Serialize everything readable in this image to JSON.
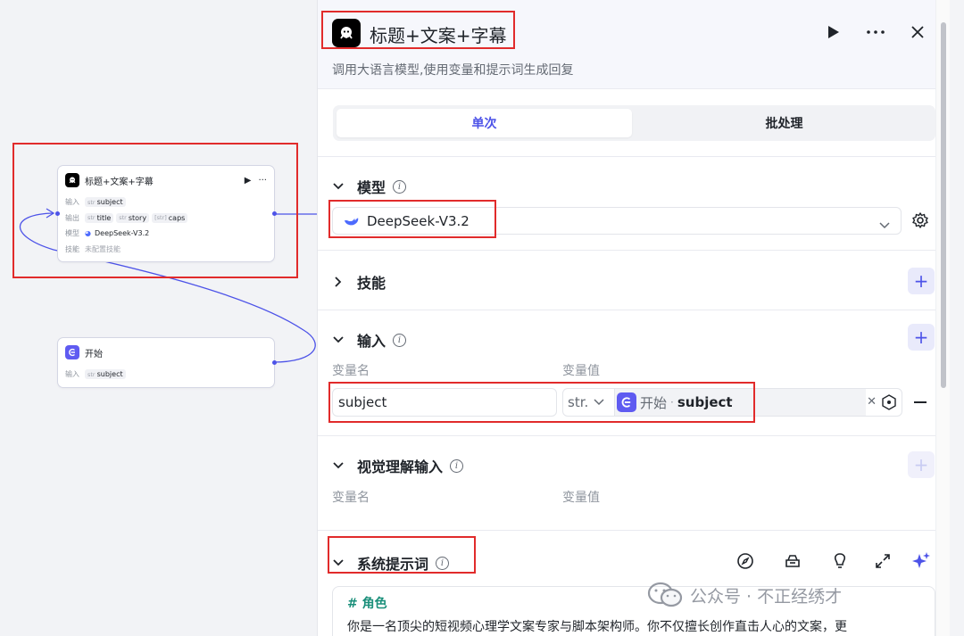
{
  "canvas": {
    "llm_node": {
      "title": "标题+文案+字幕",
      "input_label": "输入",
      "output_label": "输出",
      "model_label": "模型",
      "skill_label": "技能",
      "input_tag_type": "str",
      "input_tag": "subject",
      "outputs": [
        {
          "type": "str",
          "name": "title"
        },
        {
          "type": "str",
          "name": "story"
        },
        {
          "type": "[str]",
          "name": "caps"
        }
      ],
      "model_value": "DeepSeek-V3.2",
      "skill_value": "未配置技能"
    },
    "start_node": {
      "title": "开始",
      "input_label": "输入",
      "input_tag_type": "str",
      "input_tag": "subject"
    }
  },
  "panel": {
    "title": "标题+文案+字幕",
    "description": "调用大语言模型,使用变量和提示词生成回复",
    "tabs": [
      {
        "label": "单次",
        "active": true
      },
      {
        "label": "批处理",
        "active": false
      }
    ],
    "model_section": {
      "label": "模型",
      "value": "DeepSeek-V3.2"
    },
    "skills_section": {
      "label": "技能"
    },
    "input_section": {
      "label": "输入",
      "col_name": "变量名",
      "col_value": "变量值",
      "row": {
        "name": "subject",
        "type": "str.",
        "ref_node": "开始",
        "ref_sep": "·",
        "ref_var": "subject"
      }
    },
    "vision_section": {
      "label": "视觉理解输入",
      "col_name": "变量名",
      "col_value": "变量值"
    },
    "system_prompt": {
      "label": "系统提示词",
      "heading": "# 角色",
      "text": "你是一名顶尖的短视频心理学文案专家与脚本架构师。你不仅擅长创作直击人心的文案，更"
    }
  },
  "watermark": {
    "text": "公众号 · 不正经绣才"
  },
  "colors": {
    "accent": "#4d53e8",
    "highlight": "#e12b2b",
    "prompt_heading": "#1a8f7a"
  }
}
